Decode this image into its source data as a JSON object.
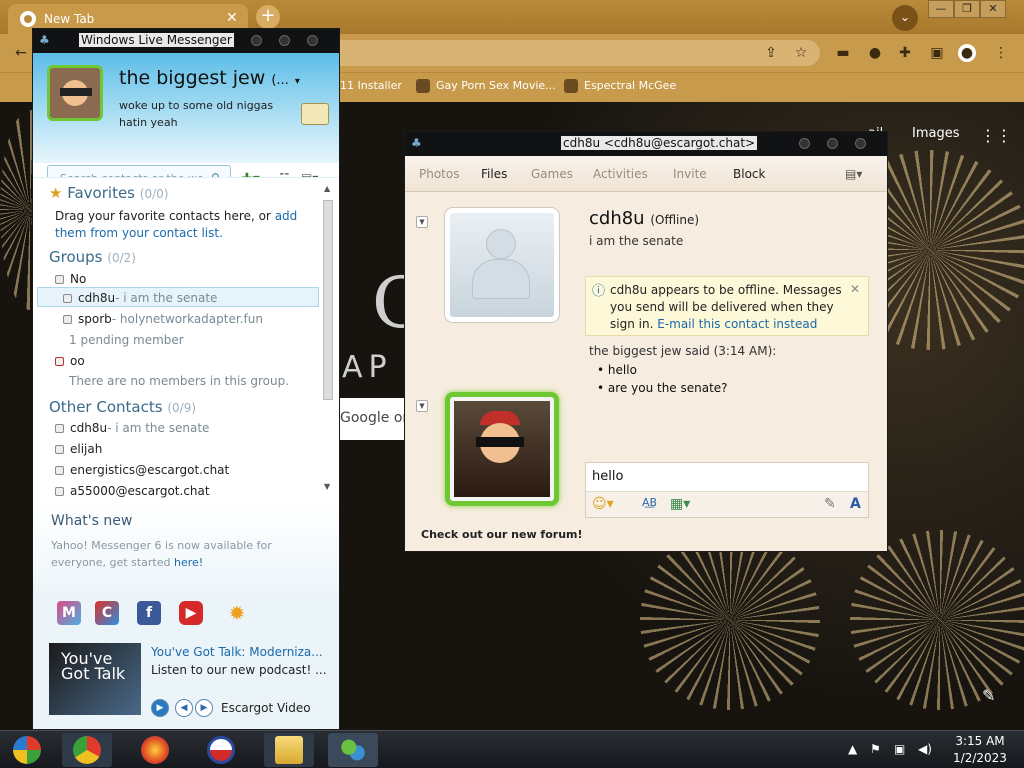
{
  "browser": {
    "tab_title": "New Tab",
    "tab_close": "✕",
    "new_tab": "+",
    "bookmarks": [
      "11 Installer",
      "Gay Porn Sex Movie...",
      "Espectral McGee"
    ],
    "links": {
      "gmail": "ail",
      "images": "Images"
    },
    "search_fragment": "Google or",
    "logo_fragment": "G",
    "date_fragment": "AP",
    "window_buttons": [
      "—",
      "❐",
      "✕"
    ]
  },
  "wlm": {
    "title": "Windows Live Messenger",
    "display_name": "the biggest jew",
    "display_name_suffix": "(...",
    "personal_message": "woke up to some old niggas hatin yeah",
    "search_placeholder": "Search contacts or the we...",
    "favorites": {
      "title": "Favorites",
      "count": "(0/0)",
      "text_before": "Drag your favorite contacts here, or",
      "link": "add them from your contact list."
    },
    "groups": {
      "title": "Groups",
      "count": "(0/2)",
      "items": [
        {
          "name": "No"
        },
        {
          "name": "cdh8u",
          "msg": "- i am the senate"
        },
        {
          "name": "sporb",
          "msg": "- holynetworkadapter.fun"
        },
        {
          "name": "1 pending member"
        },
        {
          "name": "oo"
        },
        {
          "name": "There are no members in this group."
        }
      ]
    },
    "other": {
      "title": "Other Contacts",
      "count": "(0/9)",
      "items": [
        {
          "name": "cdh8u",
          "msg": "- i am the senate"
        },
        {
          "name": "elijah"
        },
        {
          "name": "energistics@escargot.chat"
        },
        {
          "name": "a55000@escargot.chat"
        }
      ]
    },
    "whats_new": {
      "title": "What's new",
      "text": "Yahoo! Messenger 6 is now available for everyone, get started",
      "link": "here!"
    },
    "apps": [
      "M",
      "C",
      "f",
      "▶",
      "✹"
    ],
    "promo": {
      "thumb": "You've Got Talk",
      "title": "You've Got Talk: Moderniza...",
      "desc": "Listen to our new podcast! ...",
      "source": "Escargot Video"
    }
  },
  "chat": {
    "title": "cdh8u <cdh8u@escargot.chat>",
    "menu": [
      "Photos",
      "Files",
      "Games",
      "Activities",
      "Invite",
      "Block"
    ],
    "contact_name": "cdh8u",
    "contact_status": "(Offline)",
    "contact_msg": "i am the senate",
    "notice": "cdh8u appears to be offline. Messages you send will be delivered when they sign in.",
    "notice_link": "E-mail this contact instead",
    "said_header": "the biggest jew said (3:14 AM):",
    "messages": [
      "hello",
      "are you the senate?"
    ],
    "input_text": "hello",
    "footer_link": "Check out our new forum!"
  },
  "taskbar": {
    "time": "3:15 AM",
    "date": "1/2/2023"
  },
  "colors": {
    "chrome_theme": "#c79a4c",
    "wlm_blue": "#5cbde8",
    "chat_bg": "#f6ecdf",
    "link": "#1a6aaa",
    "taskbar": "#1e2226"
  }
}
